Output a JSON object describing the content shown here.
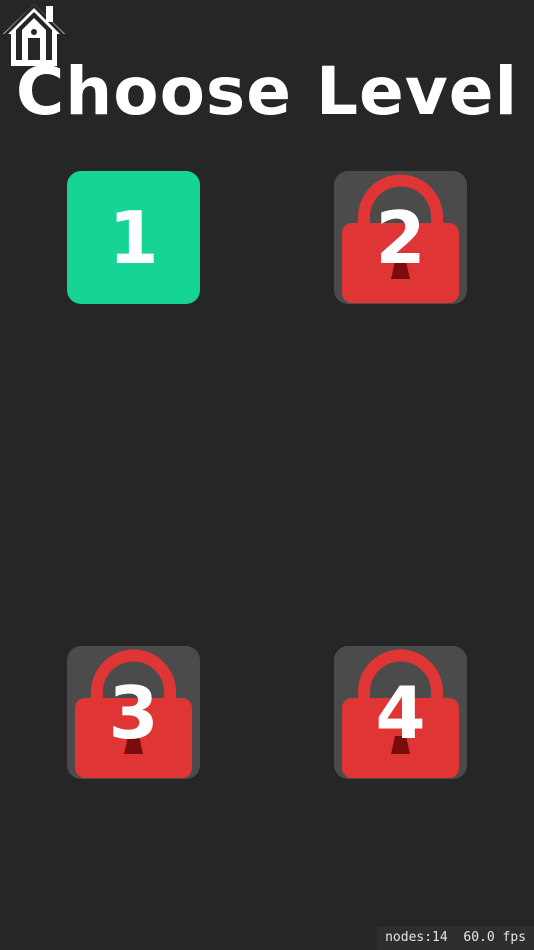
{
  "header": {
    "title": "Choose Level"
  },
  "home": {
    "icon": "house-icon"
  },
  "levels": [
    {
      "number": "1",
      "state": "unlocked"
    },
    {
      "number": "2",
      "state": "locked",
      "icon": "padlock-icon"
    },
    {
      "number": "3",
      "state": "locked",
      "icon": "padlock-icon"
    },
    {
      "number": "4",
      "state": "locked",
      "icon": "padlock-icon"
    }
  ],
  "debug": {
    "nodes": "nodes:14",
    "fps": "60.0 fps"
  },
  "colors": {
    "background": "#262626",
    "unlocked": "#16d495",
    "lock": "#e03535",
    "locked_tile": "#4b4b4b"
  }
}
